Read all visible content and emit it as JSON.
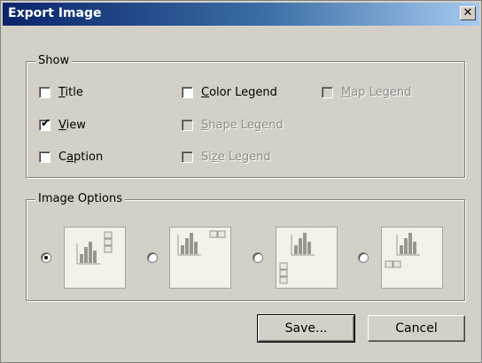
{
  "window": {
    "title": "Export Image",
    "close_glyph": "✕"
  },
  "show_group": {
    "legend": "Show",
    "options": [
      {
        "label_first": "T",
        "label_rest": "itle",
        "checked": false,
        "enabled": true
      },
      {
        "label_first": "V",
        "label_rest": "iew",
        "checked": true,
        "enabled": true
      },
      {
        "label_first": "C",
        "label_mid": "a",
        "label_rest": "ption",
        "checked": false,
        "enabled": true
      },
      {
        "label_first": "C",
        "label_rest": "olor Legend",
        "checked": false,
        "enabled": true
      },
      {
        "label_first": "S",
        "label_rest": "hape Legend",
        "checked": false,
        "enabled": false
      },
      {
        "label_first": "Si",
        "label_mid": "z",
        "label_rest": "e Legend",
        "checked": false,
        "enabled": false
      },
      {
        "label_first": "M",
        "label_rest": "ap Legend",
        "checked": false,
        "enabled": false
      }
    ]
  },
  "image_options": {
    "legend": "Image Options",
    "selected_index": 0,
    "layouts": [
      "legend-right-top",
      "legend-top-right",
      "legend-bottom-left",
      "legend-bottom-left-horizontal"
    ]
  },
  "buttons": {
    "save": "Save...",
    "cancel": "Cancel"
  }
}
